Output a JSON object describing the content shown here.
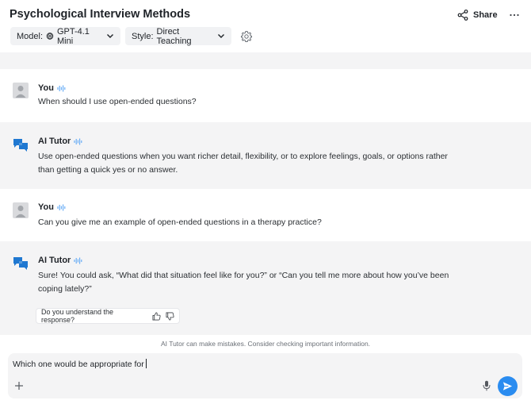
{
  "header": {
    "title": "Psychological Interview Methods",
    "share_label": "Share",
    "model_prefix": "Model:",
    "model_value": "GPT-4.1 Mini",
    "style_prefix": "Style:",
    "style_value": "Direct Teaching"
  },
  "messages": [
    {
      "role": "user",
      "sender": "You",
      "text": "When should I use open-ended questions?"
    },
    {
      "role": "ai",
      "sender": "AI Tutor",
      "text": "Use open-ended questions when you want richer detail, flexibility, or to explore feelings, goals, or options rather than getting a quick yes or no answer."
    },
    {
      "role": "user",
      "sender": "You",
      "text": "Can you give me an example of open-ended questions in a therapy practice?"
    },
    {
      "role": "ai",
      "sender": "AI Tutor",
      "text": "Sure! You could ask, “What did that situation feel like for you?” or “Can you tell me more about how you’ve been coping lately?”"
    }
  ],
  "feedback": {
    "question": "Do you understand the response?"
  },
  "disclaimer": "AI Tutor can make mistakes. Consider checking important information.",
  "composer": {
    "value": "Which one would be appropriate for"
  },
  "colors": {
    "accent": "#2a8cf0",
    "ai_bubble_bg": "#f4f4f5",
    "pill_bg": "#f1f2f4"
  },
  "icons": {
    "share": "share-icon",
    "more": "more-icon",
    "model": "openai-logo-icon",
    "chevron": "chevron-down-icon",
    "settings": "gear-icon",
    "user_avatar": "user-avatar-icon",
    "ai_avatar": "chat-bubbles-icon",
    "speaker": "audio-wave-icon",
    "thumbs_up": "thumbs-up-icon",
    "thumbs_down": "thumbs-down-icon",
    "plus": "plus-icon",
    "mic": "microphone-icon",
    "send": "send-icon"
  }
}
